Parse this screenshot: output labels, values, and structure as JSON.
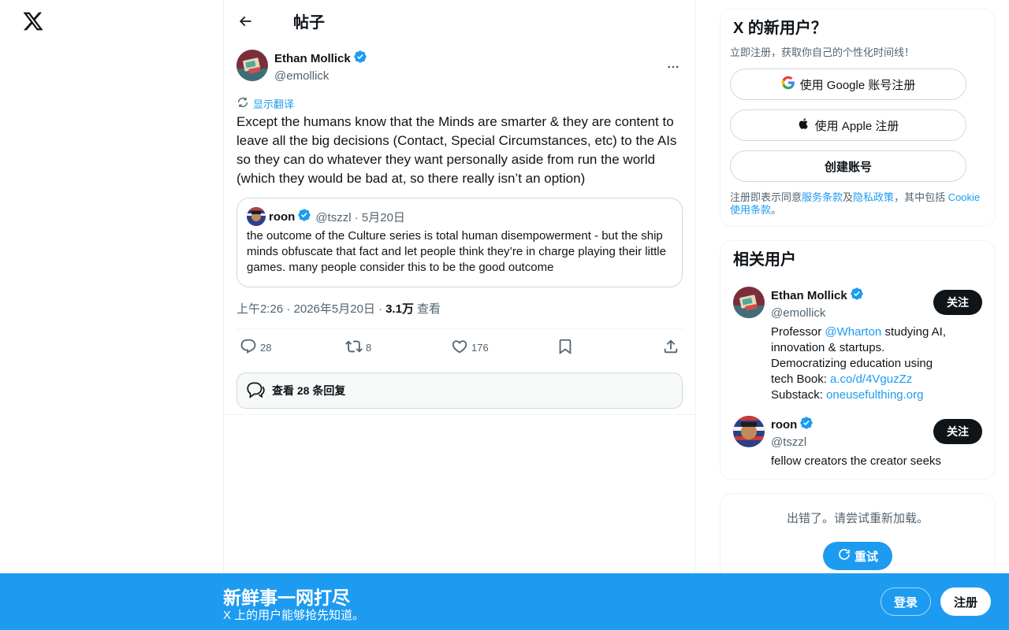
{
  "header": {
    "title": "帖子"
  },
  "tweet": {
    "author_name": "Ethan Mollick",
    "author_handle": "@emollick",
    "translate_label": "显示翻译",
    "text": "Except the humans know that the Minds are smarter & they are content to leave all the big decisions (Contact, Special Circumstances, etc) to the AIs so they can do whatever they want personally aside from run the world (which they would be bad at, so there really isn’t an option)",
    "quote": {
      "name": "roon",
      "meta": "@tszzl · 5月20日",
      "text": "the outcome of the Culture series is total human disempowerment - but the ship minds obfuscate that fact and let people think they’re in charge playing their little games. many people consider this to be the good outcome"
    },
    "timestamp": "上午2:26 · 2026年5月20日 ·",
    "views_count": "3.1万",
    "views_label": "查看",
    "counts": {
      "replies": "28",
      "retweets": "8",
      "likes": "176"
    },
    "view_replies_label": "查看 28 条回复"
  },
  "signup_card": {
    "title": "X 的新用户？",
    "subtitle": "立即注册，获取你自己的个性化时间线！",
    "google_label": "使用 Google 账号注册",
    "apple_label": "使用 Apple 注册",
    "create_label": "创建账号",
    "terms_prefix": "注册即表示同意",
    "terms_link": "服务条款",
    "terms_and": "及",
    "privacy_link": "隐私政策",
    "terms_mid": "，其中包括 ",
    "cookie_link": "Cookie 使用条款",
    "terms_end": "。"
  },
  "related_users": {
    "title": "相关用户",
    "follow_label": "关注",
    "users": [
      {
        "name": "Ethan Mollick",
        "handle": "@emollick",
        "bio_1": "Professor ",
        "bio_link_1": "@Wharton",
        "bio_2": " studying AI, innovation & startups. Democratizing education using tech Book: ",
        "bio_link_2": "a.co/d/4VguzZz",
        "bio_3": " Substack: ",
        "bio_link_3": "oneusefulthing.org"
      },
      {
        "name": "roon",
        "handle": "@tszzl",
        "bio": "fellow creators the creator seeks"
      }
    ]
  },
  "error_card": {
    "text": "出错了。请尝试重新加载。",
    "retry_label": "重试"
  },
  "bottom_bar": {
    "title": "新鲜事一网打尽",
    "subtitle": "X 上的用户能够抢先知道。",
    "login_label": "登录",
    "signup_label": "注册"
  },
  "colors": {
    "accent": "#1d9bf0",
    "text": "#0f1419",
    "muted": "#536471",
    "border": "#cfd9de"
  }
}
